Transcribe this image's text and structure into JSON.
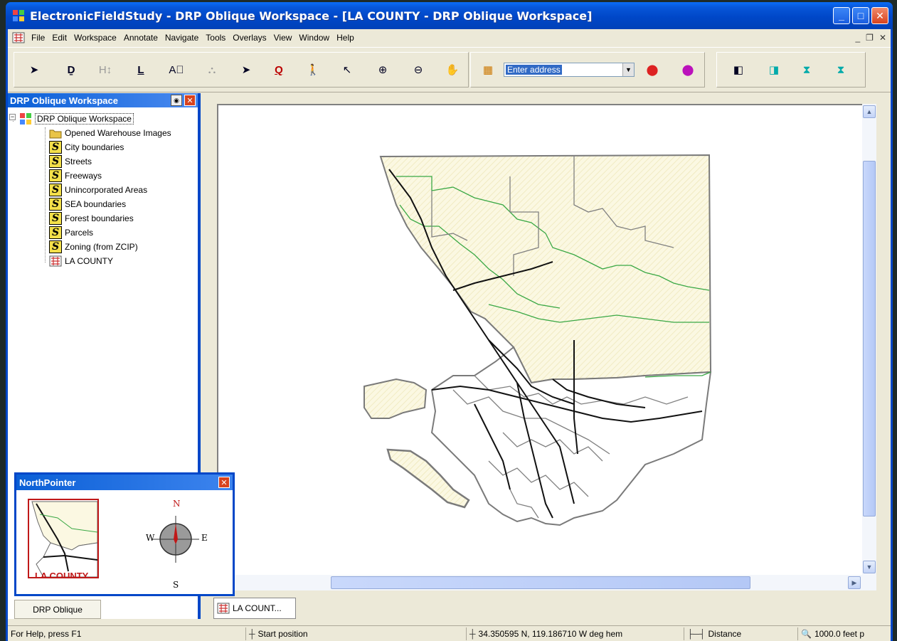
{
  "window": {
    "title": "ElectronicFieldStudy - DRP Oblique Workspace - [LA COUNTY - DRP Oblique Workspace]",
    "controls": [
      "minimize",
      "maximize",
      "close"
    ]
  },
  "menu": [
    "File",
    "Edit",
    "Workspace",
    "Annotate",
    "Navigate",
    "Tools",
    "Overlays",
    "View",
    "Window",
    "Help"
  ],
  "toolbar": {
    "address_value": "Enter address"
  },
  "workspace_panel": {
    "title": "DRP Oblique Workspace",
    "root": "DRP Oblique Workspace",
    "items": [
      {
        "label": "Opened Warehouse Images",
        "icon": "folder-icon"
      },
      {
        "label": "City boundaries",
        "icon": "shapefile-icon"
      },
      {
        "label": "Streets",
        "icon": "shapefile-icon"
      },
      {
        "label": "Freeways",
        "icon": "shapefile-icon"
      },
      {
        "label": "Unincorporated Areas",
        "icon": "shapefile-icon"
      },
      {
        "label": "SEA boundaries",
        "icon": "shapefile-icon"
      },
      {
        "label": "Forest boundaries",
        "icon": "shapefile-icon"
      },
      {
        "label": "Parcels",
        "icon": "shapefile-icon"
      },
      {
        "label": "Zoning (from ZCIP)",
        "icon": "shapefile-icon"
      },
      {
        "label": "LA COUNTY",
        "icon": "map-document-icon"
      }
    ],
    "bottom_tab": "DRP Oblique"
  },
  "northpointer": {
    "title": "NorthPointer",
    "minimap_label": "LA COUNTY",
    "compass": {
      "n": "N",
      "e": "E",
      "s": "S",
      "w": "W"
    }
  },
  "document_tab": "LA COUNT...",
  "status": {
    "help": "For Help, press F1",
    "start": "Start position",
    "coords": "34.350595 N, 119.186710 W deg hem",
    "distance": "Distance",
    "scale": "1000.0 feet p"
  },
  "colors": {
    "titlebar": "#0047c8",
    "forest_boundary": "#3aa845",
    "unincorporated_fill": "#fbf8e2",
    "freeway": "#111111",
    "city_boundary": "#808080"
  }
}
